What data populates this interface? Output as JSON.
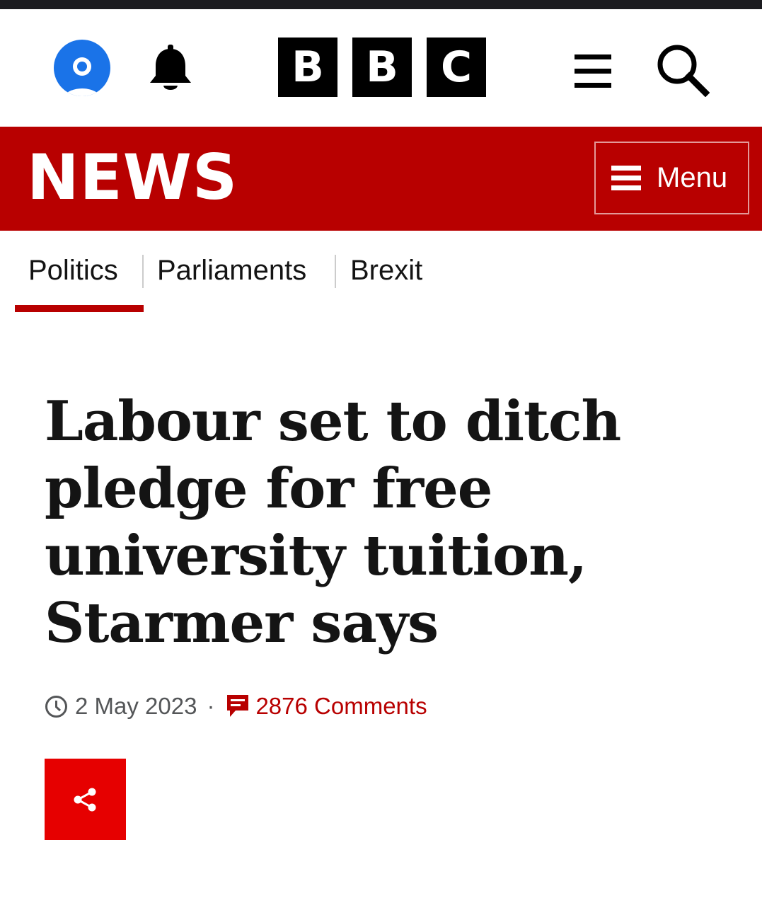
{
  "masthead": {
    "logo_letters": [
      "B",
      "B",
      "C"
    ],
    "icons": {
      "account": "account-icon",
      "notifications": "bell-icon",
      "more_menu": "hamburger-icon",
      "search": "search-icon"
    },
    "colors": {
      "account": "#1a73e8"
    }
  },
  "news_bar": {
    "wordmark": "NEWS",
    "menu_label": "Menu",
    "color": "#b80000"
  },
  "subnav": {
    "items": [
      {
        "label": "Politics",
        "active": true
      },
      {
        "label": "Parliaments",
        "active": false
      },
      {
        "label": "Brexit",
        "active": false
      }
    ]
  },
  "article": {
    "headline_lines": [
      "Labour set to ditch",
      "pledge for free",
      "university tuition,",
      "Starmer says"
    ],
    "date": "2 May 2023",
    "separator": "·",
    "comments": "2876 Comments",
    "share_icon": "share-icon",
    "share_color": "#e60000"
  }
}
